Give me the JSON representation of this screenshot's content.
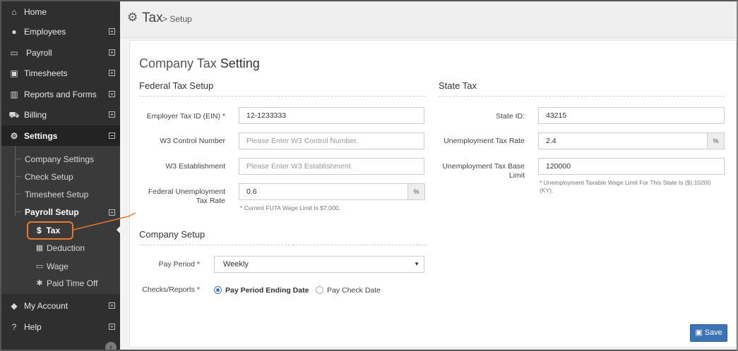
{
  "sidebar": {
    "items": [
      {
        "label": "Home",
        "icon": "home-icon",
        "glyph": "⌂",
        "expand": ""
      },
      {
        "label": "Employees",
        "icon": "user-icon",
        "glyph": "●",
        "expand": "+"
      },
      {
        "label": "Payroll",
        "icon": "monitor-icon",
        "glyph": "▭",
        "expand": "+"
      },
      {
        "label": "Timesheets",
        "icon": "inbox-icon",
        "glyph": "▣",
        "expand": "+"
      },
      {
        "label": "Reports and Forms",
        "icon": "bar-chart-icon",
        "glyph": "▥",
        "expand": "+"
      },
      {
        "label": "Billing",
        "icon": "cart-icon",
        "glyph": "⛟",
        "expand": "+"
      },
      {
        "label": "Settings",
        "icon": "cogs-icon",
        "glyph": "⚙",
        "expand": "−"
      }
    ],
    "settings_sub": [
      {
        "label": "Company Settings"
      },
      {
        "label": "Check Setup"
      },
      {
        "label": "Timesheet Setup"
      },
      {
        "label": "Payroll Setup",
        "expand": "−"
      }
    ],
    "payroll_sub": [
      {
        "label": "Tax",
        "glyph": "$"
      },
      {
        "label": "Deduction",
        "glyph": "▦"
      },
      {
        "label": "Wage",
        "glyph": "▭"
      },
      {
        "label": "Paid Time Off",
        "glyph": "✱"
      }
    ],
    "bottom": [
      {
        "label": "My Account",
        "glyph": "◆",
        "expand": "+"
      },
      {
        "label": "Help",
        "glyph": "?",
        "expand": "+"
      }
    ],
    "collapse_glyph": "‹"
  },
  "header": {
    "title": "Tax",
    "breadcrumb": "> Setup"
  },
  "page": {
    "heading_light": "Company Tax",
    "heading_bold": "Setting"
  },
  "federal": {
    "title": "Federal Tax Setup",
    "ein_label": "Employer Tax ID (EIN) *",
    "ein_value": "12-1233333",
    "w3_control_label": "W3 Control Number",
    "w3_control_placeholder": "Please Enter W3 Control Number.",
    "w3_est_label": "W3 Establishment",
    "w3_est_placeholder": "Please Enter W3 Establishment.",
    "futa_label_1": "Federal Unemployment",
    "futa_label_2": "Tax Rate",
    "futa_value": "0.6",
    "futa_addon": "%",
    "futa_help": "* Current FUTA Wage Limit Is $7,000."
  },
  "state": {
    "title": "State Tax",
    "id_label": "State ID:",
    "id_value": "43215",
    "rate_label": "Unemployment Tax Rate",
    "rate_value": "2.4",
    "rate_addon": "%",
    "base_label_1": "Unemployment Tax Base",
    "base_label_2": "Limit",
    "base_value": "120000",
    "base_help_1": "* Unemployment Taxable Wage Limit For This State Is ($):10200",
    "base_help_2": "(KY)."
  },
  "company": {
    "title": "Company Setup",
    "pay_period_label": "Pay Period *",
    "pay_period_value": "Weekly",
    "checks_label": "Checks/Reports *",
    "option_1": "Pay Period Ending Date",
    "option_2": "Pay Check Date",
    "selected_option": 1
  },
  "save_label": "Save",
  "colors": {
    "accent": "#3b74b5",
    "sidebar": "#2f2f2f",
    "annotation": "#e57a2d"
  }
}
